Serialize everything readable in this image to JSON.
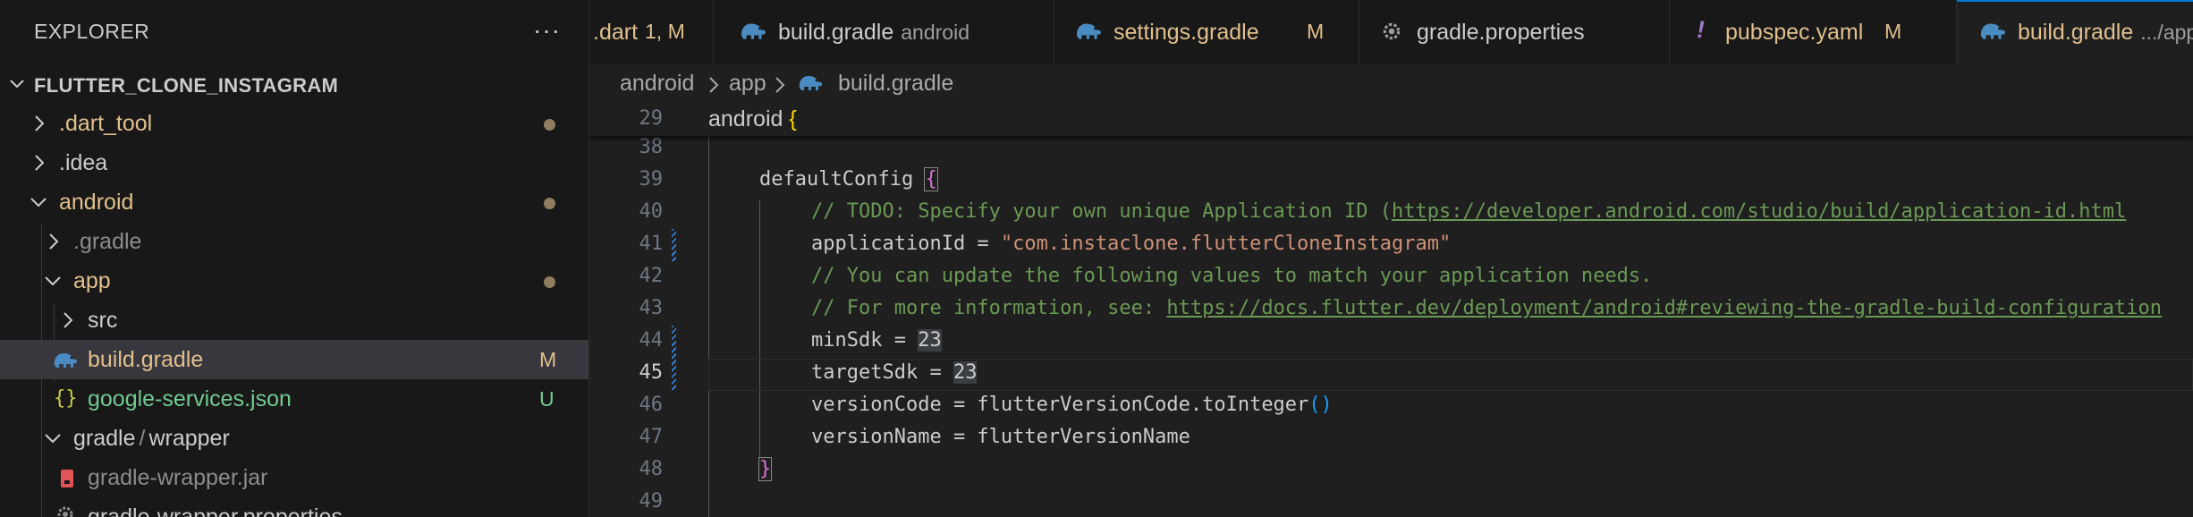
{
  "explorer": {
    "title": "EXPLORER",
    "more_label": "···",
    "project_name": "FLUTTER_CLONE_INSTAGRAM",
    "items": [
      {
        "label": ".dart_tool",
        "color": "#e2c08d",
        "status": "dot"
      },
      {
        "label": ".idea",
        "color": "#cccccc",
        "status": ""
      },
      {
        "label": "android",
        "color": "#e2c08d",
        "status": "dot"
      },
      {
        "label": ".gradle",
        "color": "#8c8c8c",
        "status": ""
      },
      {
        "label": "app",
        "color": "#e2c08d",
        "status": "dot"
      },
      {
        "label": "src",
        "color": "#cccccc",
        "status": ""
      },
      {
        "label": "build.gradle",
        "color": "#e2c08d",
        "status": "M"
      },
      {
        "label": "google-services.json",
        "color": "#73c991",
        "status": "U"
      },
      {
        "label": "gradle",
        "label2": "wrapper",
        "color": "#cccccc",
        "status": ""
      },
      {
        "label": "gradle-wrapper.jar",
        "color": "#8c8c8c",
        "status": ""
      },
      {
        "label": "gradle-wrapper.properties",
        "color": "#cccccc",
        "status": ""
      }
    ]
  },
  "tabs": [
    {
      "label": ".dart",
      "mod": "1, M",
      "color": "#e2c08d"
    },
    {
      "label": "build.gradle",
      "desc": "android",
      "mod": "",
      "color": "#cccccc"
    },
    {
      "label": "settings.gradle",
      "mod": "M",
      "color": "#e2c08d"
    },
    {
      "label": "gradle.properties",
      "mod": "",
      "color": "#cccccc"
    },
    {
      "label": "pubspec.yaml",
      "mod": "M",
      "color": "#e2c08d",
      "icon_glyph": "!"
    },
    {
      "label": "build.gradle",
      "desc": ".../app",
      "mod": "",
      "color": "#e2c08d"
    }
  ],
  "breadcrumb": {
    "android": "android",
    "app": "app",
    "file": "build.gradle"
  },
  "editor": {
    "sticky": {
      "ln": "29",
      "text": "android",
      "brace": "{"
    },
    "lines": [
      {
        "ln": "38"
      },
      {
        "ln": "39",
        "text": "defaultConfig ",
        "brace": "{"
      },
      {
        "ln": "40",
        "comment": "// TODO: Specify your own unique Application ID (",
        "link": "https://developer.android.com/studio/build/application-id.html"
      },
      {
        "ln": "41",
        "code": "applicationId = ",
        "str": "\"com.instaclone.flutterCloneInstagram\""
      },
      {
        "ln": "42",
        "comment": "// You can update the following values to match your application needs."
      },
      {
        "ln": "43",
        "comment": "// For more information, see: ",
        "link": "https://docs.flutter.dev/deployment/android#reviewing-the-gradle-build-configuration"
      },
      {
        "ln": "44",
        "code": "minSdk = ",
        "num": "23"
      },
      {
        "ln": "45",
        "code": "targetSdk = ",
        "num": "23"
      },
      {
        "ln": "46",
        "code": "versionCode = flutterVersionCode.toInteger",
        "paren": "()"
      },
      {
        "ln": "47",
        "code": "versionName = flutterVersionName"
      },
      {
        "ln": "48",
        "brace": "}"
      },
      {
        "ln": "49"
      }
    ]
  },
  "colors": {
    "accent": "#0078d4",
    "gradle_icon": "#4a8cc2",
    "modified": "#e2c08d",
    "untracked": "#73c991"
  }
}
